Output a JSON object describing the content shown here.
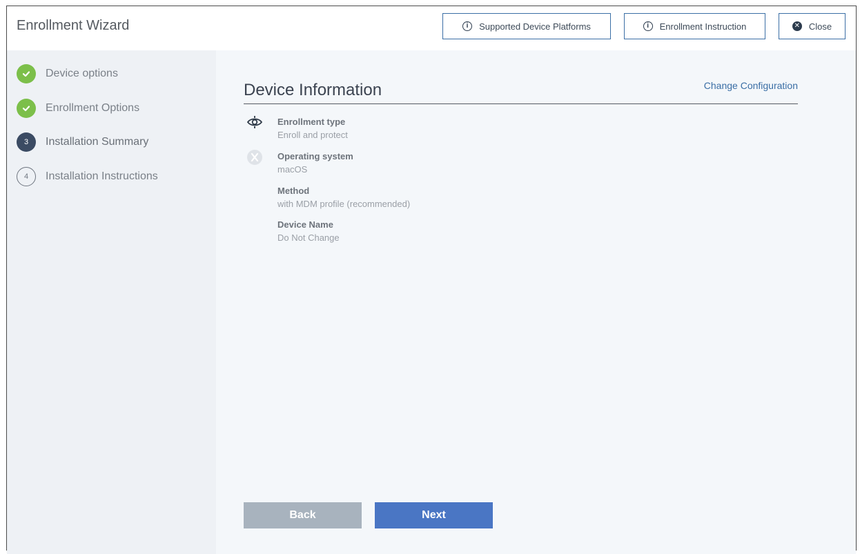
{
  "header": {
    "title": "Enrollment Wizard",
    "buttons": {
      "supported_platforms": "Supported Device Platforms",
      "enrollment_instruction": "Enrollment Instruction",
      "close": "Close"
    }
  },
  "sidebar": {
    "steps": [
      {
        "number": "",
        "label": "Device options",
        "state": "done"
      },
      {
        "number": "",
        "label": "Enrollment Options",
        "state": "done"
      },
      {
        "number": "3",
        "label": "Installation Summary",
        "state": "current"
      },
      {
        "number": "4",
        "label": "Installation Instructions",
        "state": "todo"
      }
    ]
  },
  "main": {
    "section_title": "Device Information",
    "change_link": "Change Configuration",
    "items": [
      {
        "label": "Enrollment type",
        "value": "Enroll and protect",
        "icon": "shield-eye-icon"
      },
      {
        "label": "Operating system",
        "value": "macOS",
        "icon": "macos-icon"
      },
      {
        "label": "Method",
        "value": "with MDM profile (recommended)",
        "icon": ""
      },
      {
        "label": "Device Name",
        "value": "Do Not Change",
        "icon": ""
      }
    ]
  },
  "footer": {
    "back_label": "Back",
    "next_label": "Next"
  },
  "colors": {
    "done": "#7cbf4a",
    "current": "#3b4b63",
    "accent": "#4a76c4",
    "link": "#3a6ea5"
  }
}
